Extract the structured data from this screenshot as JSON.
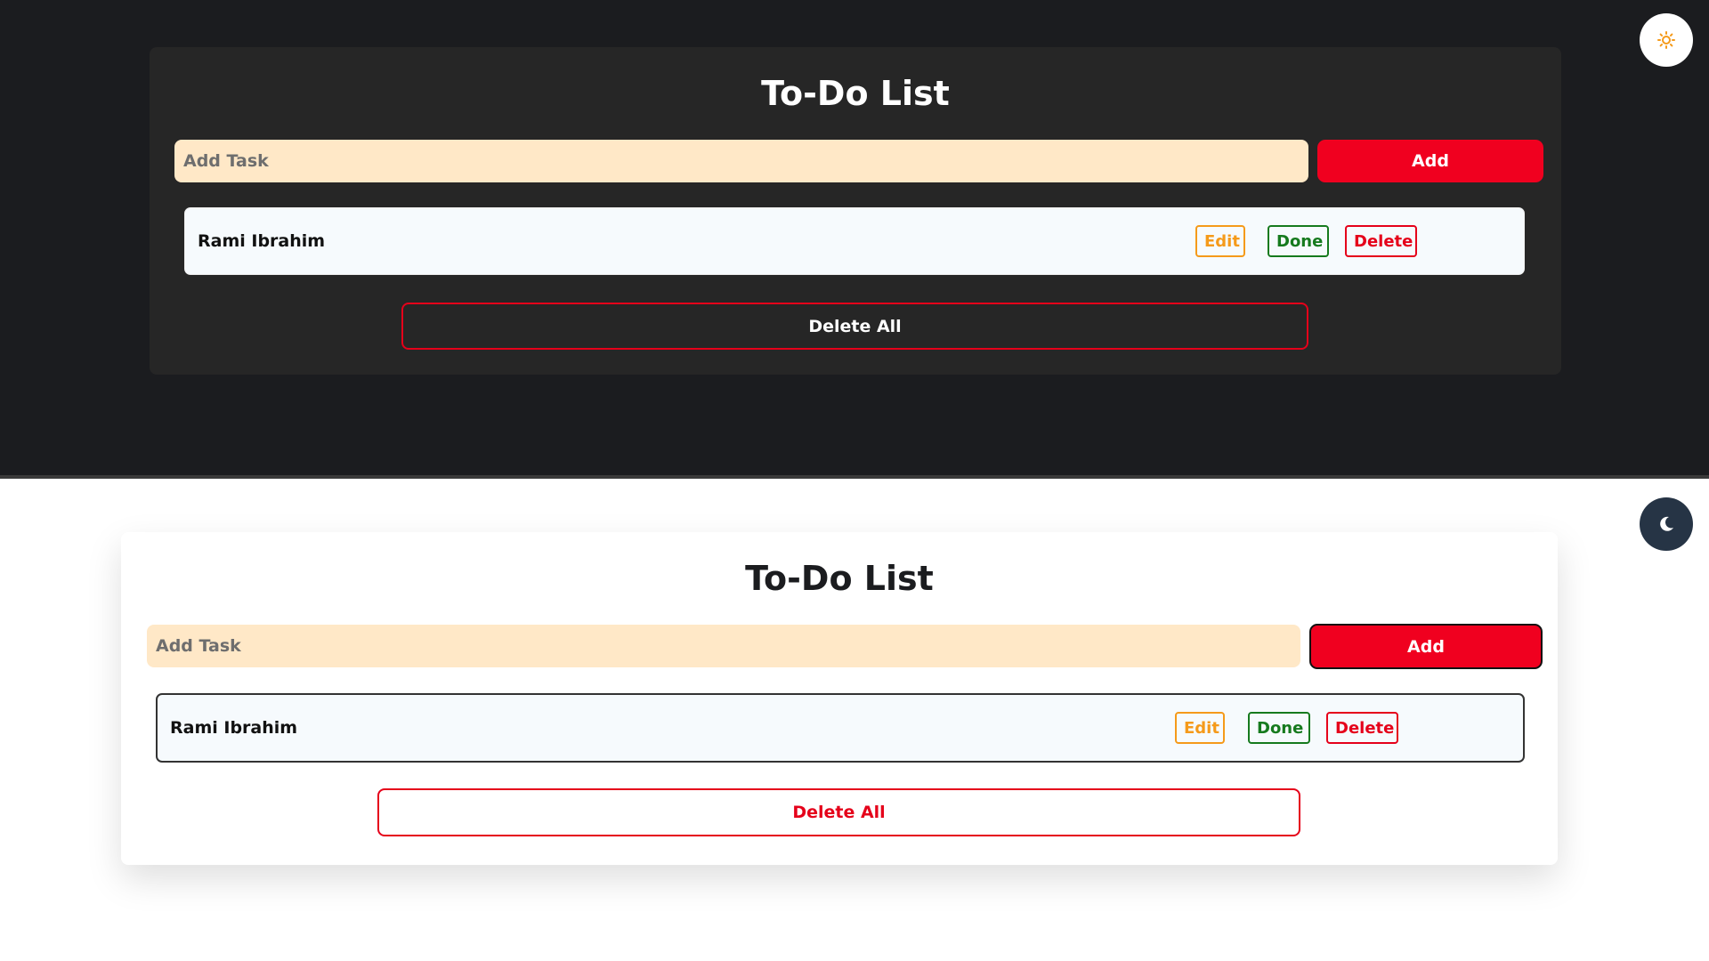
{
  "dark_view": {
    "title": "To-Do List",
    "input_placeholder": "Add Task",
    "add_label": "Add",
    "tasks": [
      {
        "text": "Rami Ibrahim",
        "edit_label": "Edit",
        "done_label": "Done",
        "delete_label": "Delete"
      }
    ],
    "delete_all_label": "Delete All",
    "theme_icon": "sun-icon"
  },
  "light_view": {
    "title": "To-Do List",
    "input_placeholder": "Add Task",
    "add_label": "Add",
    "tasks": [
      {
        "text": "Rami Ibrahim",
        "edit_label": "Edit",
        "done_label": "Done",
        "delete_label": "Delete"
      }
    ],
    "delete_all_label": "Delete All",
    "theme_icon": "moon-icon"
  },
  "colors": {
    "dark_bg": "#1b1c1f",
    "dark_card": "#262626",
    "light_bg": "#ffffff",
    "accent_red": "#f0001f",
    "input_bg": "#ffe8c7",
    "edit_orange": "#f59a1a",
    "done_green": "#167a1e",
    "sun_color": "#f59a1a",
    "moon_bg": "#263445"
  }
}
